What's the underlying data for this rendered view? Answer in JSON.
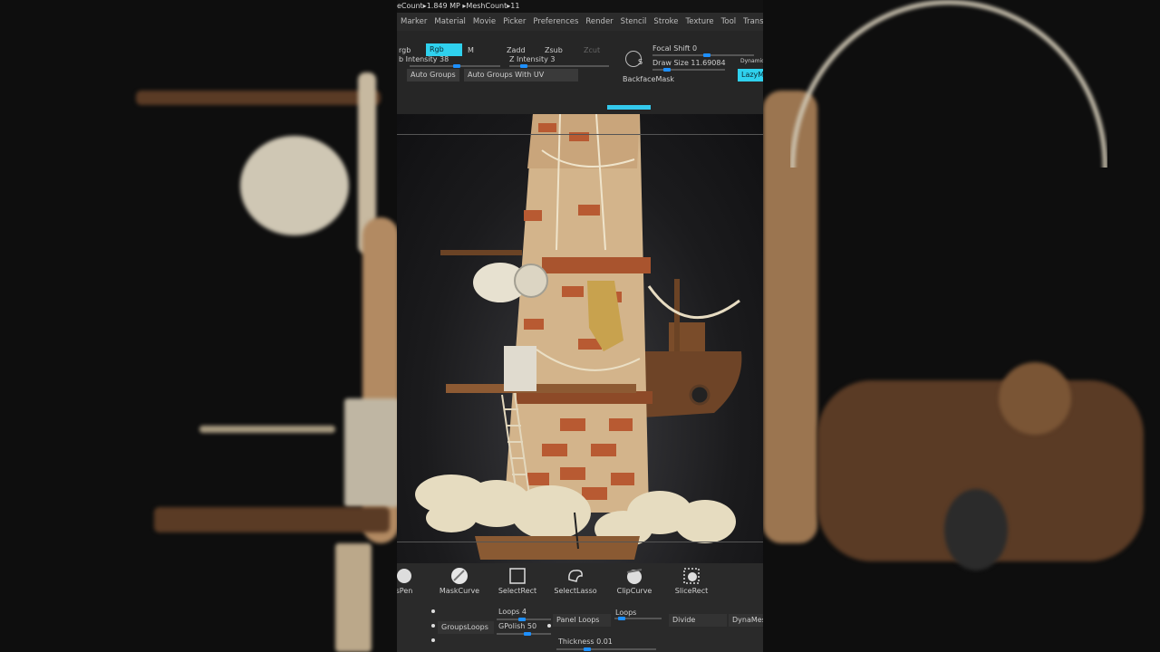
{
  "status": {
    "text": "eCount▸1.849 MP  ▸MeshCount▸11"
  },
  "menu": [
    "Marker",
    "Material",
    "Movie",
    "Picker",
    "Preferences",
    "Render",
    "Stencil",
    "Stroke",
    "Texture",
    "Tool",
    "Transf"
  ],
  "toolbar": {
    "rgb_label": "rgb",
    "rgb_button": "Rgb",
    "m_button": "M",
    "zadd": "Zadd",
    "zsub": "Zsub",
    "zcut": "Zcut",
    "rgb_intensity": "b Intensity 38",
    "z_intensity": "Z Intensity 3",
    "focal_shift": "Focal Shift 0",
    "draw_size": "Draw Size 11.69084",
    "dynamic": "Dynamic",
    "lazy": "LazyM",
    "auto_groups": "Auto Groups",
    "auto_groups_uv": "Auto Groups With UV",
    "backface_mask": "BackfaceMask",
    "s_icon": "S"
  },
  "tools": [
    {
      "label": "sPen",
      "icon": "sphere-brush-icon"
    },
    {
      "label": "MaskCurve",
      "icon": "mask-sphere-icon"
    },
    {
      "label": "SelectRect",
      "icon": "select-rect-icon"
    },
    {
      "label": "SelectLasso",
      "icon": "select-lasso-icon"
    },
    {
      "label": "ClipCurve",
      "icon": "clip-sphere-icon"
    },
    {
      "label": "SliceRect",
      "icon": "slice-rect-icon"
    }
  ],
  "panel": {
    "loops4": "Loops 4",
    "gpolish": "GPolish 50",
    "groups_loops": "GroupsLoops",
    "panel_loops": "Panel Loops",
    "loops": "Loops",
    "divide": "Divide",
    "dynamesh": "DynaMes",
    "thickness": "Thickness 0.01"
  },
  "colors": {
    "accent": "#2fd1ee",
    "slider": "#1e90ff"
  }
}
